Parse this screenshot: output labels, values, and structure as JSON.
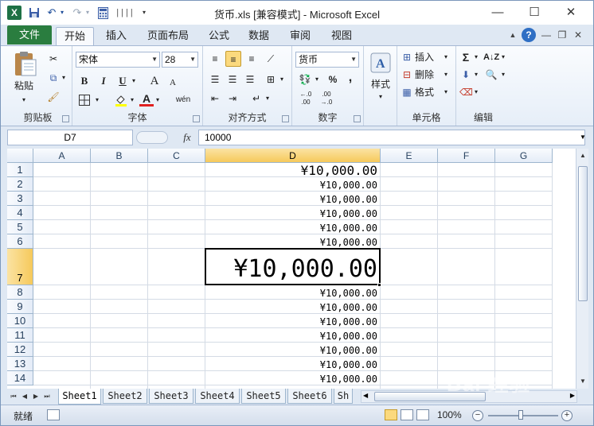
{
  "titlebar": {
    "app_icon_letter": "X",
    "title": "货币.xls [兼容模式] - Microsoft Excel",
    "min": "—",
    "max": "☐",
    "close": "✕"
  },
  "qat": {
    "save": "💾",
    "undo": "↶",
    "redo": "↷",
    "more": "▾"
  },
  "tabs": {
    "file": "文件",
    "items": [
      "开始",
      "插入",
      "页面布局",
      "公式",
      "数据",
      "审阅",
      "视图"
    ],
    "active": "开始"
  },
  "ribbon": {
    "clipboard": {
      "paste": "粘贴",
      "label": "剪贴板"
    },
    "font": {
      "name": "宋体",
      "size": "28",
      "bold": "B",
      "italic": "I",
      "underline": "U",
      "grow": "A",
      "shrink": "A",
      "color_letter": "A",
      "phonetic": "wén",
      "label": "字体"
    },
    "align": {
      "label": "对齐方式"
    },
    "number": {
      "format": "货币",
      "percent": "%",
      "comma": ",",
      "label": "数字"
    },
    "styles": {
      "label": "样式"
    },
    "cells": {
      "insert": "插入",
      "delete": "删除",
      "format": "格式",
      "label": "单元格"
    },
    "edit": {
      "sum": "Σ",
      "label": "编辑"
    }
  },
  "formula_bar": {
    "name_box": "D7",
    "fx": "fx",
    "value": "10000"
  },
  "grid": {
    "columns": [
      "A",
      "B",
      "C",
      "D",
      "E",
      "F",
      "G"
    ],
    "selected_col": "D",
    "rows": [
      {
        "num": "1",
        "value": "¥10,000.00"
      },
      {
        "num": "2",
        "value": "¥10,000.00"
      },
      {
        "num": "3",
        "value": "¥10,000.00"
      },
      {
        "num": "4",
        "value": "¥10,000.00"
      },
      {
        "num": "5",
        "value": "¥10,000.00"
      },
      {
        "num": "6",
        "value": "¥10,000.00"
      },
      {
        "num": "7",
        "value": "¥10,000.00"
      },
      {
        "num": "8",
        "value": "¥10,000.00"
      },
      {
        "num": "9",
        "value": "¥10,000.00"
      },
      {
        "num": "10",
        "value": "¥10,000.00"
      },
      {
        "num": "11",
        "value": "¥10,000.00"
      },
      {
        "num": "12",
        "value": "¥10,000.00"
      },
      {
        "num": "13",
        "value": "¥10,000.00"
      },
      {
        "num": "14",
        "value": "¥10,000.00"
      }
    ],
    "selected_row": "7"
  },
  "sheets": [
    "Sheet1",
    "Sheet2",
    "Sheet3",
    "Sheet4",
    "Sheet5",
    "Sheet6",
    "Sh"
  ],
  "active_sheet": "Sheet1",
  "status": {
    "ready": "就绪",
    "zoom": "100%",
    "minus": "−",
    "plus": "+"
  },
  "watermark": "Bai 经验"
}
